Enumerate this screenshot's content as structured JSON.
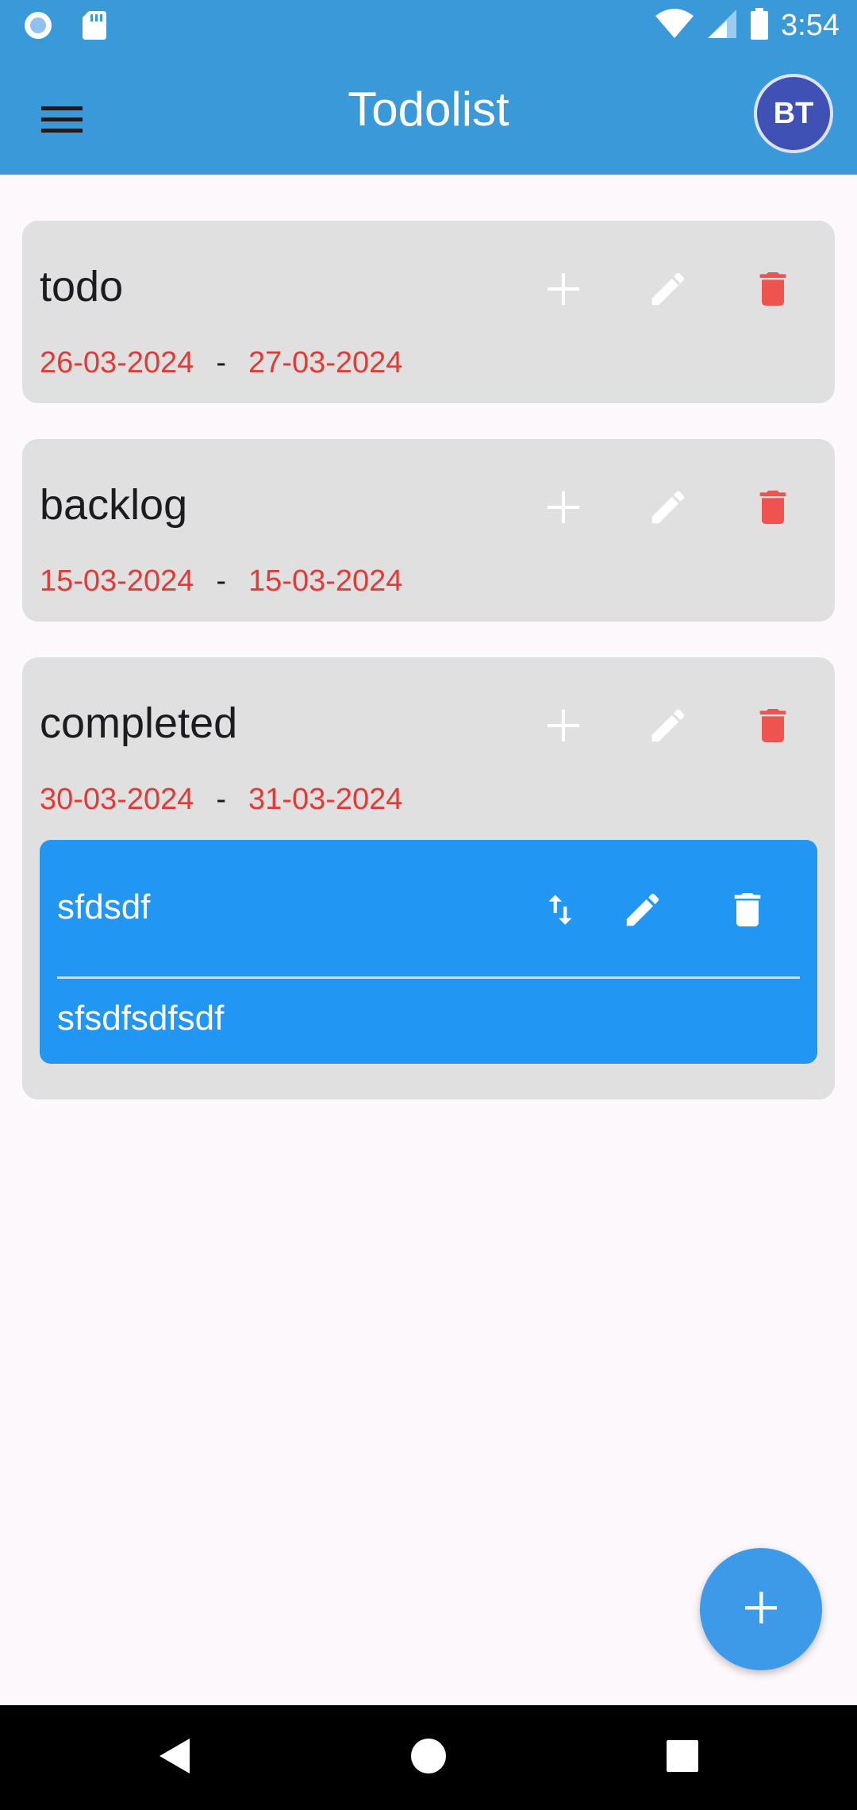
{
  "status_bar": {
    "time": "3:54",
    "icons": [
      "radio-icon",
      "sd-card-icon",
      "wifi-icon",
      "signal-icon",
      "battery-icon"
    ]
  },
  "app_bar": {
    "title": "Todolist",
    "menu_icon": "menu-icon",
    "avatar_initials": "BT",
    "background": "#3a9ad9"
  },
  "lists": [
    {
      "name": "todo",
      "start_date": "26-03-2024",
      "separator": "-",
      "end_date": "27-03-2024",
      "actions": [
        "add-icon",
        "edit-icon",
        "delete-icon"
      ],
      "tasks": []
    },
    {
      "name": "backlog",
      "start_date": "15-03-2024",
      "separator": "-",
      "end_date": "15-03-2024",
      "actions": [
        "add-icon",
        "edit-icon",
        "delete-icon"
      ],
      "tasks": []
    },
    {
      "name": "completed",
      "start_date": "30-03-2024",
      "separator": "-",
      "end_date": "31-03-2024",
      "actions": [
        "add-icon",
        "edit-icon",
        "delete-icon"
      ],
      "tasks": [
        {
          "title": "sfdsdf",
          "description": "sfsdfsdfsdf",
          "actions": [
            "swap-vert-icon",
            "edit-icon",
            "delete-icon"
          ]
        }
      ]
    }
  ],
  "fab": {
    "icon": "add-icon"
  },
  "nav_bar": {
    "buttons": [
      "back-icon",
      "home-icon",
      "recents-icon"
    ]
  },
  "colors": {
    "card_background": "#e0e0e0",
    "task_background": "#2196f3",
    "date_color": "#e53935",
    "delete_color": "#ef5350",
    "fab_background": "#3d9ae8"
  }
}
